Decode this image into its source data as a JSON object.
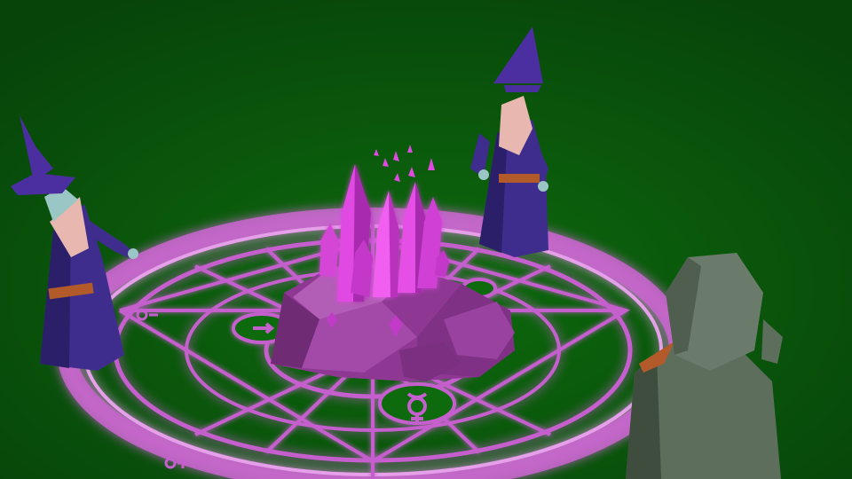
{
  "scene": {
    "description_hidden": "",
    "colors": {
      "background": "#0a5a0a",
      "background_dark": "#083f08",
      "circle_glow": "#d06ad6",
      "circle_line": "#b24fc0",
      "circle_fill_dark": "#1f6e1f",
      "crystal_bright": "#f050f0",
      "crystal_mid": "#c027c6",
      "rock": "#9a3f9e",
      "rock_dark": "#6f2b74",
      "wizard_robe": "#3f2d8e",
      "wizard_robe_shadow": "#2c1f6a",
      "wizard_hat": "#4b2ea0",
      "wizard_beard": "#e8b7b0",
      "wizard_skin": "#9bc6c6",
      "belt": "#b35a2a",
      "hooded_figure": "#5d6e5d",
      "hooded_figure_dark": "#3f4d3f"
    },
    "icons": [
      "alchemy-circle",
      "mercury-symbol",
      "crystal-cluster",
      "wizard",
      "hooded-figure"
    ]
  }
}
